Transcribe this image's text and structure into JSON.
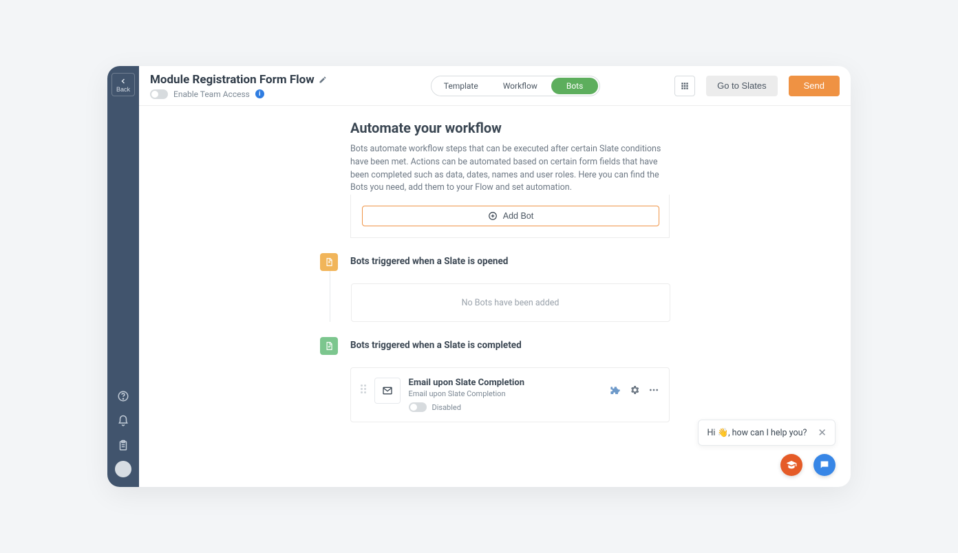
{
  "sidebar": {
    "back_label": "Back"
  },
  "header": {
    "title": "Module Registration Form Flow",
    "team_access_label": "Enable Team Access",
    "tabs": {
      "template": "Template",
      "workflow": "Workflow",
      "bots": "Bots"
    },
    "go_to_slates": "Go to Slates",
    "send": "Send"
  },
  "intro": {
    "heading": "Automate your workflow",
    "body": "Bots automate workflow steps that can be executed after certain Slate conditions have been met. Actions can be automated based on certain form fields that have been completed such as data, dates, names and user roles. Here you can find the Bots you need, add them to your Flow and set automation.",
    "add_bot": "Add Bot"
  },
  "sections": {
    "opened": {
      "title": "Bots triggered when a Slate is opened",
      "empty": "No Bots have been added"
    },
    "completed": {
      "title": "Bots triggered when a Slate is completed"
    }
  },
  "bot": {
    "title": "Email upon Slate Completion",
    "subtitle": "Email upon Slate Completion",
    "status": "Disabled"
  },
  "chat": {
    "greeting": "Hi 👋, how can I help you?"
  }
}
